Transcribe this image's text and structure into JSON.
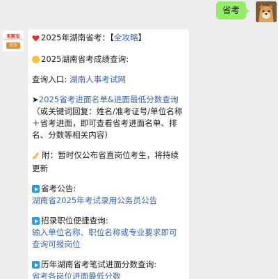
{
  "user_message": {
    "text": "省考"
  },
  "bot": {
    "logo_title": "来聚宝",
    "logo_subtitle": "RENJUBAO.COM",
    "logo_city": "长沙",
    "line1_prefix": "2025年湖南省考：【",
    "line1_link": "全攻略",
    "line1_suffix": "】",
    "line2": "2025湖南省考成绩查询:",
    "line3_prefix": "查询入口: ",
    "line3_link": "湖南人事考试网",
    "line4_arrow": "➤",
    "line4_link": "2025省考进面名单&进面最低分数查询",
    "line4_note": "（或关键词回复：姓名/准考证号/单位名称＋省考进面，即可查看省考进面名单、排名、分数等相关内容）",
    "line5": "附：暂时仅公布省直岗位考生，将持续更新",
    "line6_title": "省考公告:",
    "line6_link": "湖南省2025年考试录用公务员公告",
    "line7_title": "招录职位便捷查询:",
    "line7_link": "输入单位名称、职位名称或专业要求即可查询可报岗位",
    "line8_title": "历年湖南省考笔试进面分数查询:",
    "line8_link": "省考各岗位进面最低分数"
  },
  "icons": {
    "heart": "heart-icon",
    "dot": "orange-circle-icon",
    "pen": "writing-hand-icon",
    "play": "play-button-icon"
  }
}
